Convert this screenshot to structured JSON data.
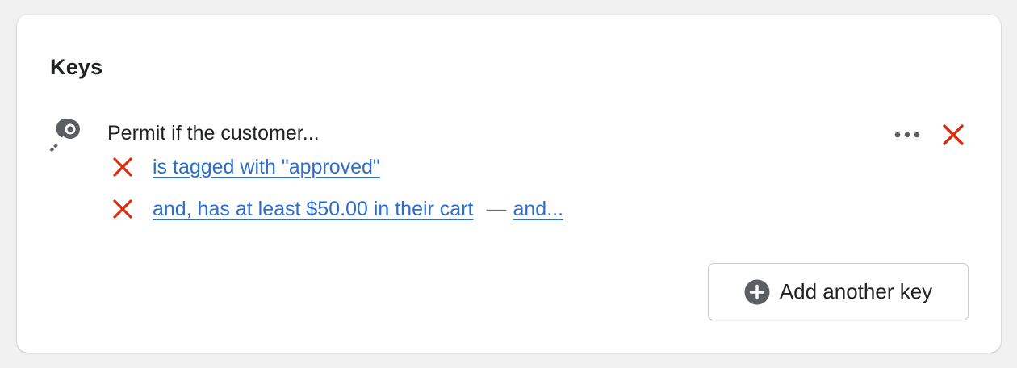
{
  "keys_card": {
    "title": "Keys",
    "rule": {
      "icon": "key-icon",
      "heading": "Permit if the customer...",
      "conditions": [
        {
          "text": "is tagged with \"approved\""
        },
        {
          "text": "and, has at least $50.00 in their cart",
          "separator": "—",
          "more_link": "and..."
        }
      ]
    },
    "add_button_label": "Add another key"
  },
  "colors": {
    "link": "#2c6ecb",
    "remove": "#d72c0d",
    "icon": "#5c5f62"
  }
}
